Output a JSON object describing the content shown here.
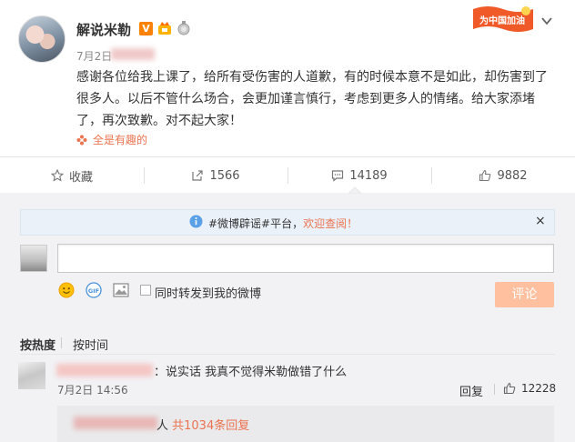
{
  "post": {
    "username": "解说米勒",
    "verified_badge": "V",
    "date": "7月2日",
    "content": "感谢各位给我上课了，给所有受伤害的人道歉，有的时候本意不是如此，却伤害到了很多人。以后不管什么场合，会更加谨言慎行，考虑到更多人的情绪。给大家添堵了，再次致歉。对不起大家！",
    "source_label": "全是有趣的",
    "banner_text": "为中国加油"
  },
  "actions": {
    "favorite_label": "收藏",
    "repost_count": "1566",
    "comment_count": "14189",
    "like_count": "9882"
  },
  "notice": {
    "prefix": "#微博辟谣#平台，",
    "highlight": "欢迎查阅！",
    "close": "×"
  },
  "composer": {
    "input_value": "",
    "repost_label": "同时转发到我的微博",
    "submit_label": "评论"
  },
  "sort": {
    "hot_label": "按热度",
    "time_label": "按时间"
  },
  "comment": {
    "text": "：说实话 我真不觉得米勒做错了什么",
    "date": "7月2日 14:56",
    "reply_label": "回复",
    "likes": "12228",
    "sub_reply_suffix": "人 ",
    "sub_reply_count": "共1034条回复"
  },
  "colors": {
    "accent": "#eb7350",
    "brand_orange": "#ff8200",
    "submit_disabled": "#ffc09f"
  },
  "icons": [
    "star-icon",
    "repost-icon",
    "comment-icon",
    "like-icon",
    "info-icon",
    "emoji-icon",
    "gif-icon",
    "image-icon",
    "chevron-down-icon",
    "flower-icon"
  ]
}
